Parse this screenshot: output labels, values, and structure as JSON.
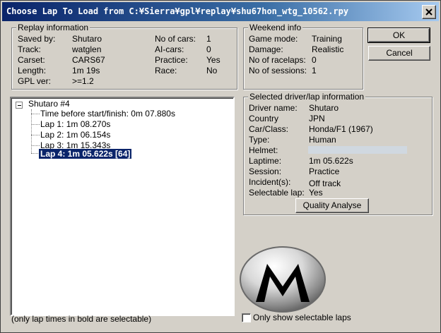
{
  "window": {
    "title": "Choose Lap To Load from C:¥Sierra¥gpl¥replay¥shu67hon_wtg_10562.rpy"
  },
  "replay_info": {
    "legend": "Replay information",
    "left": [
      {
        "label": "Saved by:",
        "value": "Shutaro"
      },
      {
        "label": "Track:",
        "value": "watglen"
      },
      {
        "label": "Carset:",
        "value": "CARS67"
      },
      {
        "label": "Length:",
        "value": "1m 19s"
      },
      {
        "label": "GPL ver:",
        "value": ">=1.2"
      }
    ],
    "right": [
      {
        "label": "No of cars:",
        "value": "1"
      },
      {
        "label": "AI-cars:",
        "value": "0"
      },
      {
        "label": "Practice:",
        "value": "Yes"
      },
      {
        "label": "Race:",
        "value": "No"
      }
    ]
  },
  "weekend_info": {
    "legend": "Weekend info",
    "rows": [
      {
        "label": "Game mode:",
        "value": "Training"
      },
      {
        "label": "Damage:",
        "value": "Realistic"
      },
      {
        "label": "No of racelaps:",
        "value": "0"
      },
      {
        "label": "No of sessions:",
        "value": "1"
      }
    ]
  },
  "buttons": {
    "ok": "OK",
    "cancel": "Cancel",
    "quality": "Quality Analyse"
  },
  "tree": {
    "root": "Shutaro #4",
    "items": [
      "Time before start/finish: 0m 07.880s",
      "Lap 1: 1m 08.270s",
      "Lap 2: 1m 06.154s",
      "Lap 3: 1m 15.343s",
      "Lap 4: 1m 05.622s [64]"
    ],
    "selected_index": 4
  },
  "driver_info": {
    "legend": "Selected driver/lap information",
    "rows": [
      {
        "label": "Driver name:",
        "value": "Shutaro"
      },
      {
        "label": "Country",
        "value": "JPN"
      },
      {
        "label": "Car/Class:",
        "value": "Honda/F1 (1967)"
      },
      {
        "label": "Type:",
        "value": "Human"
      },
      {
        "label": "Helmet:",
        "value": ""
      },
      {
        "label": "Laptime:",
        "value": "1m 05.622s"
      },
      {
        "label": "Session:",
        "value": "Practice"
      },
      {
        "label": "Incident(s):",
        "value": "Off track"
      },
      {
        "label": "Selectable lap:",
        "value": "Yes"
      }
    ]
  },
  "footer": {
    "note": "(only lap times in bold are selectable)",
    "checkbox_label": "Only show selectable laps",
    "checkbox_checked": false
  },
  "icons": {
    "close": "close-icon",
    "logo": "m-logo-icon"
  },
  "colors": {
    "titlebar_start": "#0a246a",
    "titlebar_end": "#a6caf0",
    "selection": "#0a246a",
    "face": "#d4d0c8"
  }
}
